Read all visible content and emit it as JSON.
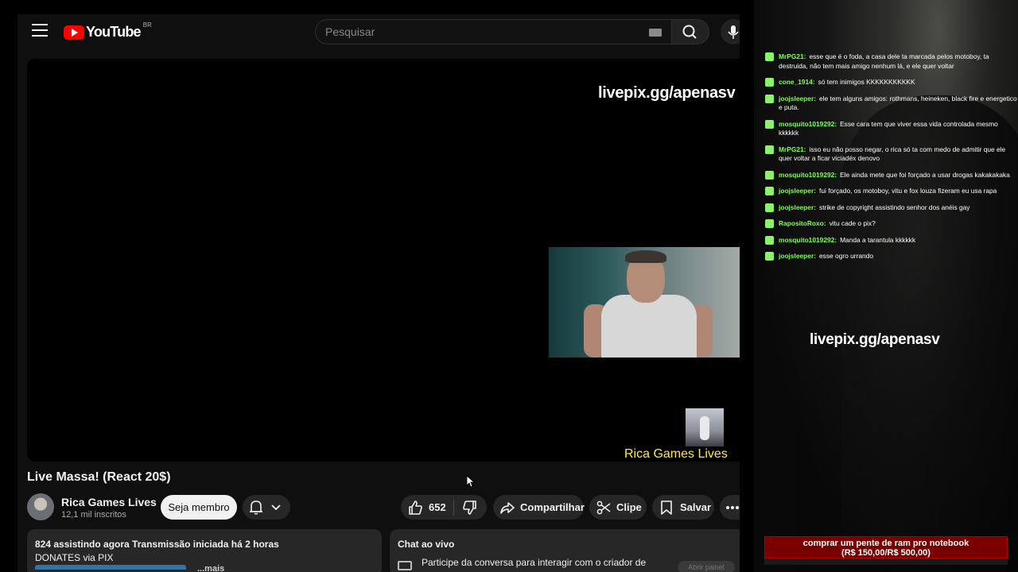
{
  "masthead": {
    "logo_text": "YouTube",
    "country_code": "BR",
    "search_placeholder": "Pesquisar"
  },
  "player": {
    "overlay_url": "livepix.gg/apenasv",
    "overlay_channel": "Rica Games Lives"
  },
  "video": {
    "title": "Live Massa! (React 20$)",
    "channel_name": "Rica Games Lives",
    "subscribers": "12,1 mil inscritos",
    "member_label": "Seja membro",
    "likes": "652",
    "share_label": "Compartilhar",
    "clip_label": "Clipe",
    "save_label": "Salvar"
  },
  "description": {
    "line1": "824 assistindo agora  Transmissão iniciada há 2 horas",
    "line2": "DONATES via PIX",
    "more": "...mais"
  },
  "live_chat_box": {
    "title": "Chat ao vivo",
    "text": "Participe da conversa para interagir com o criador de",
    "open_label": "Abrir painel"
  },
  "side_chat": [
    {
      "user": "MrPG21:",
      "text": "esse que é o foda, a casa dele ta marcada pelos motoboy, ta destruida, não tem mais amigo nenhum lá, e ele quer voltar"
    },
    {
      "user": "cone_1914:",
      "text": "só tem inimigos KKKKKKKKKKK"
    },
    {
      "user": "joojsleeper:",
      "text": "ele tem alguns amigos: rothmans, heineken, black fire e energetico e puta."
    },
    {
      "user": "mosquito1019292:",
      "text": "Esse cara tem que viver essa vida controlada mesmo kkkkkk"
    },
    {
      "user": "MrPG21:",
      "text": "isso eu não posso negar, o rica só ta com medo de admitir que ele quer voltar a ficar viciadéx denovo"
    },
    {
      "user": "mosquito1019292:",
      "text": "Ele ainda mete que foi forçado a usar drogas kakakakaka"
    },
    {
      "user": "joojsleeper:",
      "text": "fui forçado, os motoboy, vitu e fox louza fizeram eu usa rapa"
    },
    {
      "user": "joojsleeper:",
      "text": "strike de copyright assistindo senhor dos anéis gay"
    },
    {
      "user": "RapositoRoxo:",
      "text": "vitu cade o pix?"
    },
    {
      "user": "mosquito1019292:",
      "text": "Manda a tarantula kkkkkk"
    },
    {
      "user": "joojsleeper:",
      "text": "esse ogro urrando"
    }
  ],
  "side_overlay": {
    "url": "livepix.gg/apenasv",
    "goal_line1": "comprar um pente de ram pro notebook",
    "goal_line2": "(R$ 150,00/R$ 500,00)",
    "goal_progress_fraction": 0.3
  },
  "icons": {
    "menu": "menu-icon",
    "search": "search-icon",
    "mic": "mic-icon",
    "keyboard": "keyboard-icon",
    "bell": "bell-icon",
    "like": "thumbs-up-icon",
    "dislike": "thumbs-down-icon",
    "share": "share-icon",
    "clip": "scissors-icon",
    "save": "bookmark-icon",
    "more": "more-horizontal-icon"
  },
  "colors": {
    "youtube_red": "#ff0000",
    "chat_username": "#7dff4f",
    "overlay_channel_yellow": "#ffe94a",
    "goal_bar_red": "#7a0000"
  }
}
